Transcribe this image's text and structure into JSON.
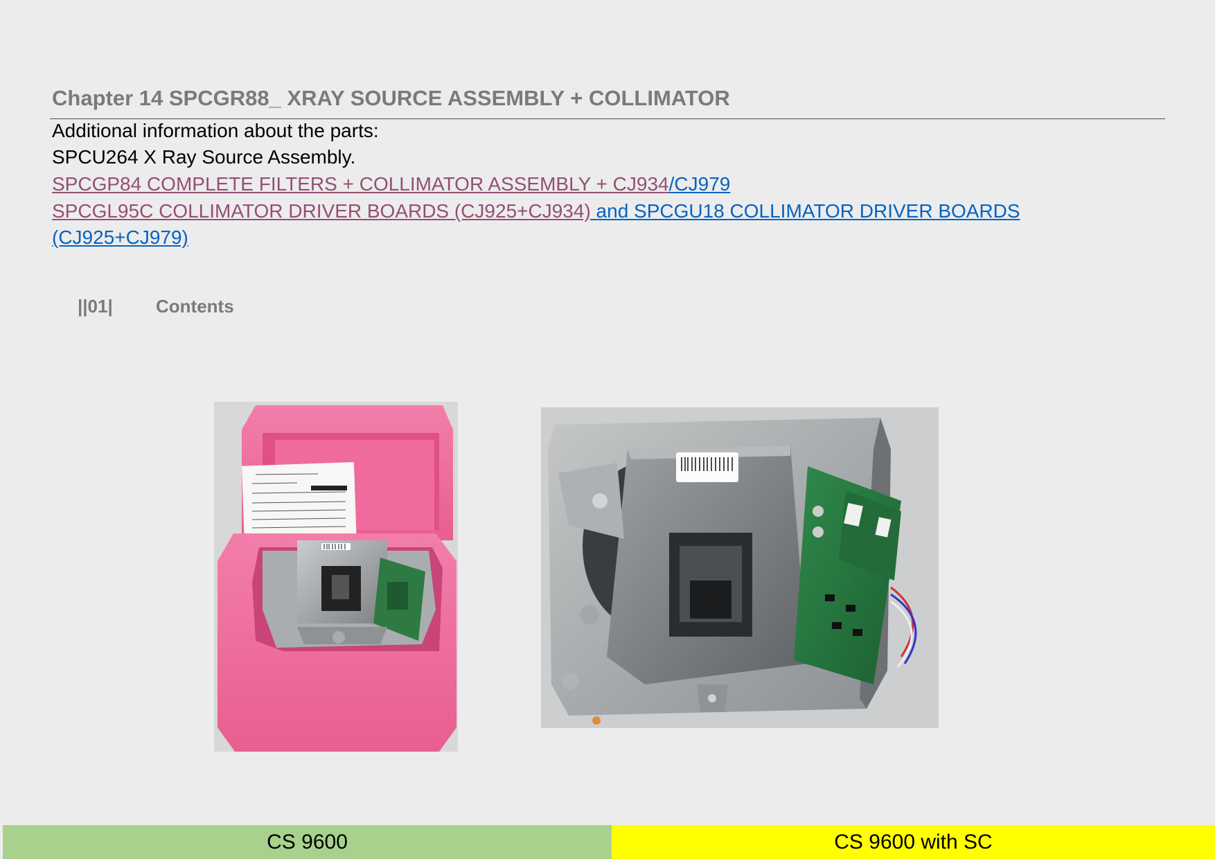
{
  "chapter_title": "Chapter 14 SPCGR88_ XRAY SOURCE ASSEMBLY + COLLIMATOR",
  "body": {
    "intro": "Additional information about the parts:",
    "source_assembly": "SPCU264 X Ray Source Assembly.",
    "link_filters_a": "SPCGP84   COMPLETE FILTERS + COLLIMATOR ASSEMBLY + CJ934",
    "link_filters_b": "/CJ979",
    "link_boards_a": "SPCGL95C COLLIMATOR DRIVER BOARDS (CJ925+CJ934)",
    "link_boards_b": " and SPCGU18 COLLIMATOR DRIVER BOARDS",
    "link_boards_c": "(CJ925+CJ979)"
  },
  "contents": {
    "number": "||01|",
    "label": "Contents"
  },
  "photos": {
    "left_barcode": "packaged-assembly",
    "right_barcode": "collimator-assembly"
  },
  "footer": {
    "left_label": "CS 9600",
    "right_label": "CS 9600 with SC",
    "left_color": "#a9d18e",
    "right_color": "#ffff00"
  }
}
